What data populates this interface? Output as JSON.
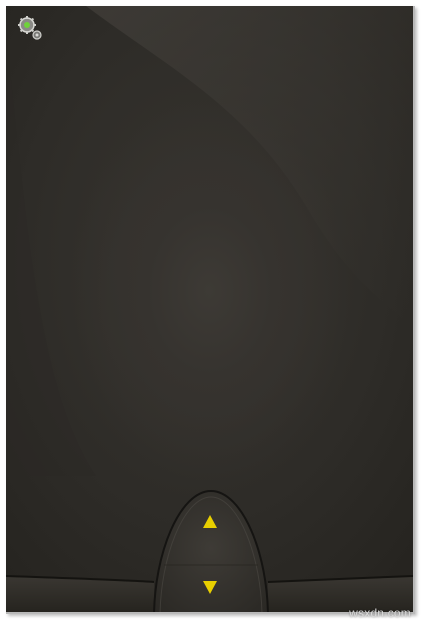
{
  "app": {
    "watermark": "wsxdn.com"
  },
  "icons": {
    "settings": "gears-icon",
    "up": "triangle-up-icon",
    "down": "triangle-down-icon"
  },
  "colors": {
    "background": "#2f2d29",
    "arrow": "#e8cf00",
    "settings_gear_green": "#6fd23a",
    "pod_outline": "#151412"
  }
}
